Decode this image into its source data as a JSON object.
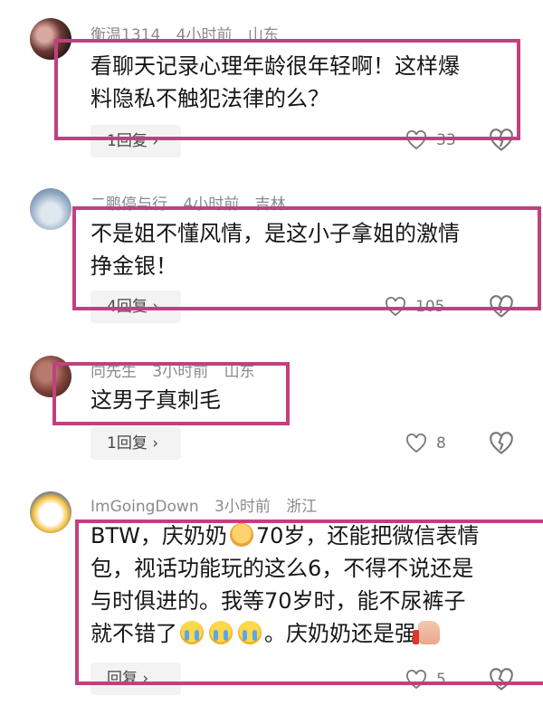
{
  "comments": [
    {
      "username": "衡温1314",
      "time": "4小时前",
      "location": "山东",
      "text_lines": [
        "看聊天记录心理年龄很年轻啊！这样爆",
        "料隐私不触犯法律的么？"
      ],
      "replies": "1回复 ›",
      "likes": "33"
    },
    {
      "username": "二鹏停与行",
      "time": "4小时前",
      "location": "吉林",
      "text_lines": [
        "不是姐不懂风情，是这小子拿姐的激情",
        "挣金银！"
      ],
      "replies": "4回复 ›",
      "likes": "105"
    },
    {
      "username": "向先生",
      "time": "3小时前",
      "location": "山东",
      "text_lines": [
        "这男子真刺毛"
      ],
      "replies": "1回复 ›",
      "likes": "8"
    },
    {
      "username": "ImGoingDown",
      "time": "3小时前",
      "location": "浙江",
      "text_line1_a": "BTW，庆奶奶",
      "text_line1_b": "70岁，还能把微信表情",
      "text_line2": "包，视话功能玩的这么6，不得不说还是",
      "text_line3": "与时俱进的。我等70岁时，能不尿裤子",
      "text_line4_a": "就不错了",
      "text_line4_b": "。庆奶奶还是强",
      "replies": "回复 ›",
      "likes": "5"
    }
  ],
  "colors": {
    "frame": "#c2407f",
    "meta_text": "#8a8a8a"
  },
  "icons": {
    "like": "heart-icon",
    "dislike": "broken-heart-icon"
  }
}
